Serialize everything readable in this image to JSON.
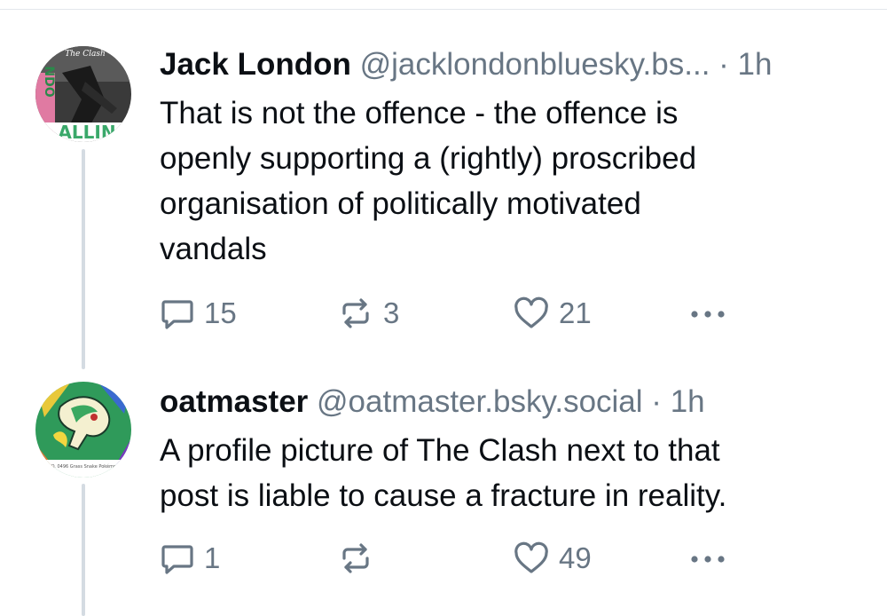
{
  "posts": [
    {
      "author": {
        "display_name": "Jack London",
        "handle": "@jacklondonbluesky.bs...",
        "avatar_text": "The Clash"
      },
      "separator": "·",
      "time": "1h",
      "lines": [
        "That is not the offence - the offence is",
        "openly supporting a (rightly) proscribed",
        "organisation of politically motivated",
        "vandals"
      ],
      "counts": {
        "replies": "15",
        "reposts": "3",
        "likes": "21"
      }
    },
    {
      "author": {
        "display_name": "oatmaster",
        "handle": "@oatmaster.bsky.social",
        "avatar_text": "NO. 0496 Grass Snake Pokémon"
      },
      "separator": "·",
      "time": "1h",
      "lines": [
        "A profile picture of The Clash next to that",
        "post is liable to cause a fracture in reality."
      ],
      "counts": {
        "replies": "1",
        "reposts": "",
        "likes": "49"
      }
    }
  ],
  "icons": {
    "reply": "reply-bubble-icon",
    "repost": "repost-arrows-icon",
    "like": "heart-icon",
    "more": "more-options-icon"
  },
  "colors": {
    "text": "#0b0f14",
    "muted": "#687684",
    "thread_line": "#d4dbe2",
    "divider": "#e3e7ec"
  }
}
